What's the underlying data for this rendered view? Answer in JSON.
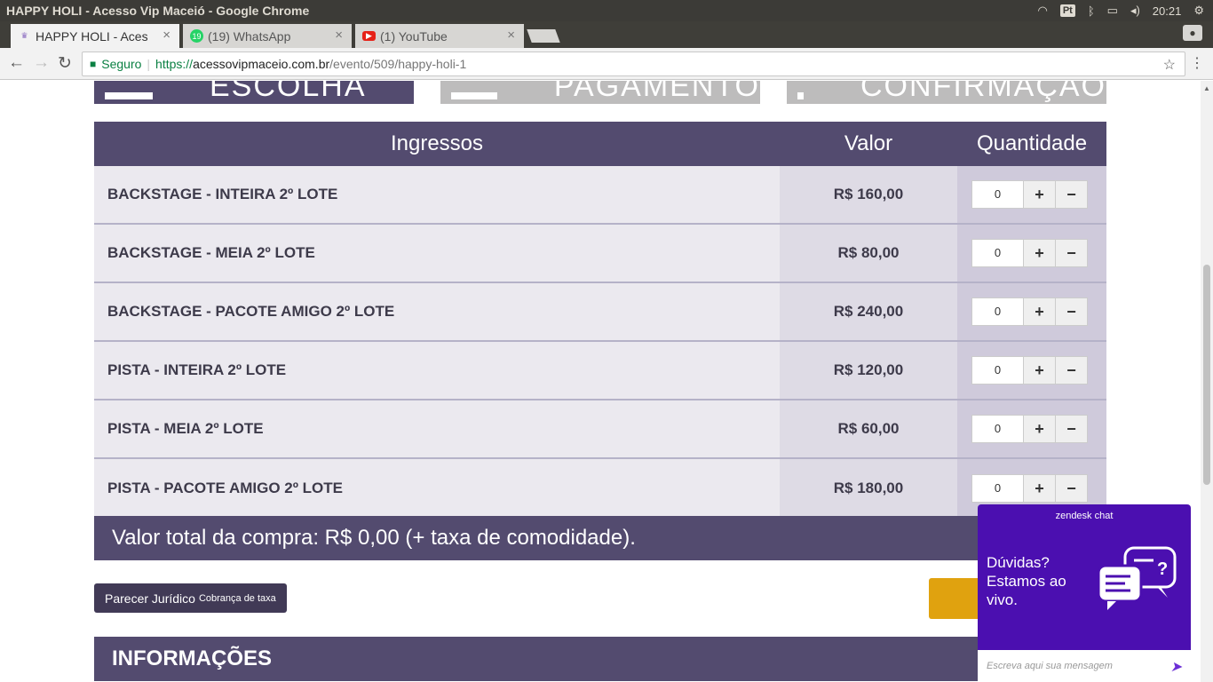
{
  "os_bar": {
    "window_title": "HAPPY HOLI - Acesso Vip Maceió - Google Chrome",
    "keyboard_layout": "Pt",
    "clock": "20:21"
  },
  "tabs": [
    {
      "label": "HAPPY HOLI - Aces",
      "active": true
    },
    {
      "label": "(19) WhatsApp",
      "badge": "19",
      "active": false
    },
    {
      "label": "(1) YouTube",
      "active": false
    }
  ],
  "toolbar": {
    "secure_label": "Seguro",
    "url_scheme": "https://",
    "url_host": "acessovipmaceio.com.br",
    "url_path": "/evento/509/happy-holi-1"
  },
  "steps": [
    {
      "label": "ESCOLHA",
      "color": "#534b6f"
    },
    {
      "label": "PAGAMENTO",
      "color": "#bdbcbc"
    },
    {
      "label": "CONFIRMAÇÃO",
      "color": "#bdbcbc"
    }
  ],
  "tickets": {
    "headers": {
      "name": "Ingressos",
      "price": "Valor",
      "qty": "Quantidade"
    },
    "rows": [
      {
        "name": "BACKSTAGE - INTEIRA 2º LOTE",
        "price": "R$ 160,00",
        "qty": "0"
      },
      {
        "name": "BACKSTAGE - MEIA 2º LOTE",
        "price": "R$ 80,00",
        "qty": "0"
      },
      {
        "name": "BACKSTAGE - PACOTE AMIGO 2º LOTE",
        "price": "R$ 240,00",
        "qty": "0"
      },
      {
        "name": "PISTA - INTEIRA 2º LOTE",
        "price": "R$ 120,00",
        "qty": "0"
      },
      {
        "name": "PISTA - MEIA 2º LOTE",
        "price": "R$ 60,00",
        "qty": "0"
      },
      {
        "name": "PISTA - PACOTE AMIGO 2º LOTE",
        "price": "R$ 180,00",
        "qty": "0"
      }
    ],
    "plus": "+",
    "minus": "−"
  },
  "total": "Valor total da compra: R$ 0,00 (+ taxa de comodidade).",
  "legal_button": {
    "main": "Parecer Jurídico",
    "small": "Cobrança de taxa"
  },
  "info_title": "INFORMAÇÕES",
  "chat": {
    "brand": "zendesk chat",
    "message": "Dúvidas? Estamos ao vivo.",
    "placeholder": "Escreva aqui sua mensagem"
  },
  "colors": {
    "primary": "#534b6f",
    "accent": "#e0a20f",
    "chat": "#4b0fb0"
  }
}
